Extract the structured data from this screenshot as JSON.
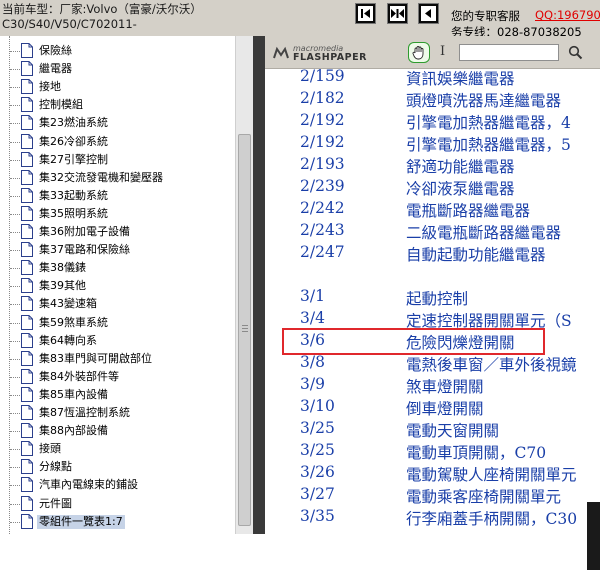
{
  "header": {
    "car_line1": "当前车型：厂家:Volvo（富豪/沃尔沃）",
    "car_line2": "C30/S40/V50/C702011-",
    "service_label": "您的专职客服",
    "qq_label": "QQ:196790",
    "hotline_label": "务专线：028-87038205",
    "nav_buttons": [
      {
        "name": "first-page-icon"
      },
      {
        "name": "expand-icon"
      },
      {
        "name": "previous-page-icon"
      }
    ]
  },
  "tree": {
    "items": [
      {
        "label": "保險絲"
      },
      {
        "label": "繼電器"
      },
      {
        "label": "接地"
      },
      {
        "label": "控制模組"
      },
      {
        "label": "集23燃油系統"
      },
      {
        "label": "集26冷卻系統"
      },
      {
        "label": "集27引擎控制"
      },
      {
        "label": "集32交流發電機和變壓器"
      },
      {
        "label": "集33起動系統"
      },
      {
        "label": "集35照明系統"
      },
      {
        "label": "集36附加電子設備"
      },
      {
        "label": "集37電路和保險絲"
      },
      {
        "label": "集38儀錶"
      },
      {
        "label": "集39其他"
      },
      {
        "label": "集43變速箱"
      },
      {
        "label": "集59煞車系統"
      },
      {
        "label": "集64轉向系"
      },
      {
        "label": "集83車門與可開啟部位"
      },
      {
        "label": "集84外裝部件等"
      },
      {
        "label": "集85車內設備"
      },
      {
        "label": "集87恆溫控制系統"
      },
      {
        "label": "集88內部設備"
      },
      {
        "label": "接頭"
      },
      {
        "label": "分線點"
      },
      {
        "label": "汽車內電線束的鋪設"
      },
      {
        "label": "元件圖"
      },
      {
        "label": "零組件一覽表1:7",
        "selected": true
      }
    ]
  },
  "viewer": {
    "logo_top": "macromedia",
    "logo_bottom": "FLASHPAPER",
    "text_tool": "I",
    "search_value": "",
    "lines": [
      {
        "page": "2/159",
        "title": "資訊娛樂繼電器"
      },
      {
        "page": "2/182",
        "title": "頭燈噴洗器馬達繼電器"
      },
      {
        "page": "2/192",
        "title": "引擎電加熱器繼電器，4"
      },
      {
        "page": "2/192",
        "title": "引擎電加熱器繼電器，5"
      },
      {
        "page": "2/193",
        "title": "舒適功能繼電器"
      },
      {
        "page": "2/239",
        "title": "冷卻液泵繼電器"
      },
      {
        "page": "2/242",
        "title": "電瓶斷路器繼電器"
      },
      {
        "page": "2/243",
        "title": "二級電瓶斷路器繼電器"
      },
      {
        "page": "2/247",
        "title": "自動起動功能繼電器"
      },
      {
        "page": "3/1",
        "title": "起動控制"
      },
      {
        "page": "3/4",
        "title": "定速控制器開關單元（S"
      },
      {
        "page": "3/6",
        "title": "危險閃爍燈開關"
      },
      {
        "page": "3/8",
        "title": "電熱後車窗／車外後視鏡"
      },
      {
        "page": "3/9",
        "title": "煞車燈開關"
      },
      {
        "page": "3/10",
        "title": "倒車燈開關"
      },
      {
        "page": "3/25",
        "title": "電動天窗開關"
      },
      {
        "page": "3/25",
        "title": "電動車頂開關，C70"
      },
      {
        "page": "3/26",
        "title": "電動駕駛人座椅開關單元"
      },
      {
        "page": "3/27",
        "title": "電動乘客座椅開關單元"
      },
      {
        "page": "3/35",
        "title": "行李廂蓋手柄開關，C30"
      }
    ]
  },
  "colors": {
    "doc_text": "#1a3fa8",
    "highlight_border": "#e0282c",
    "header_bg": "#d4d0c8",
    "qq_red": "#e00000"
  }
}
